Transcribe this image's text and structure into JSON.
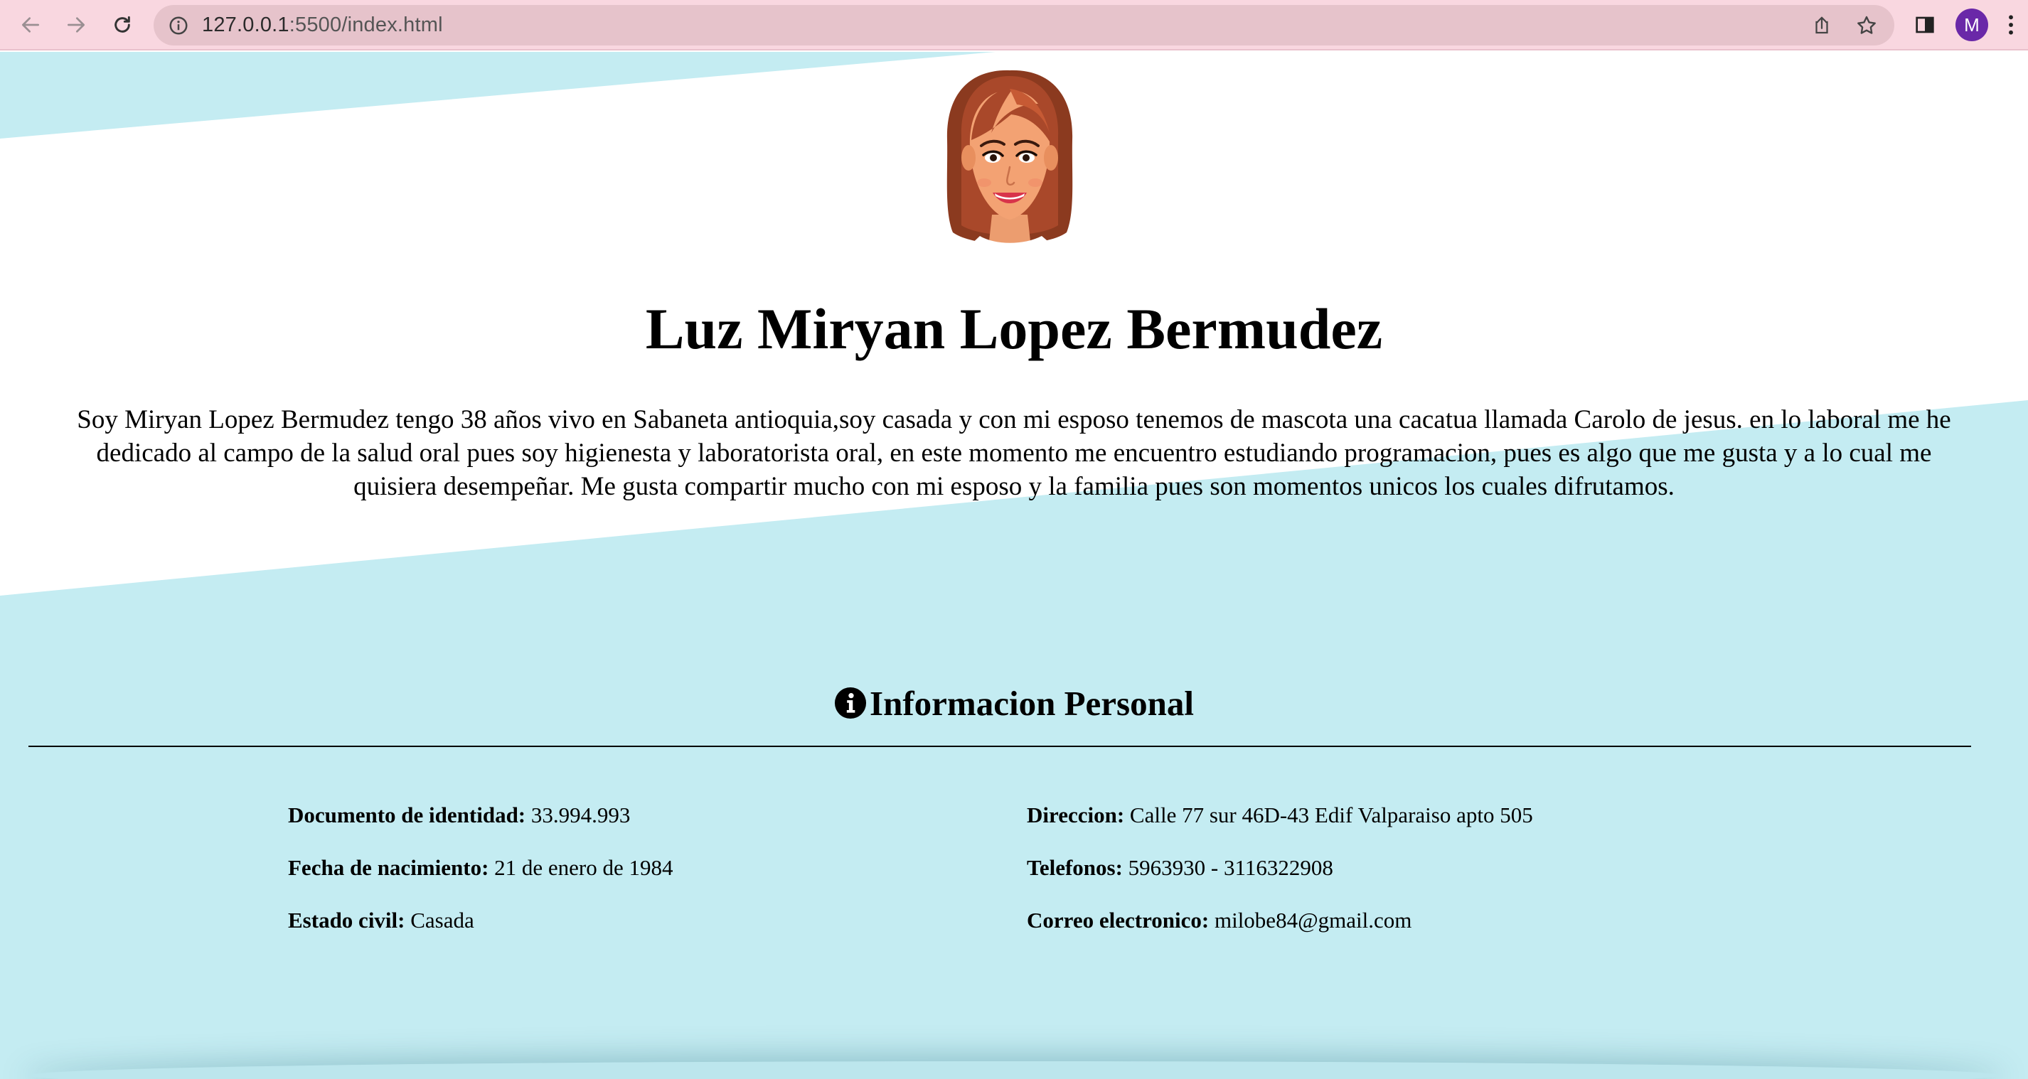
{
  "browser": {
    "url_host": "127.0.0.1",
    "url_path": ":5500/index.html",
    "profile_initial": "M",
    "icons": {
      "back": "arrow-left-icon",
      "forward": "arrow-right-icon",
      "reload": "reload-icon",
      "site_info": "info-circle-icon",
      "share": "share-icon",
      "bookmark": "star-icon",
      "side_panel": "side-panel-icon",
      "menu": "kebab-menu-icon"
    },
    "colors": {
      "chrome_bg": "#f9d7e0",
      "omnibox_bg": "#e6c3cb",
      "avatar_bg": "#6a28a8"
    }
  },
  "page": {
    "colors": {
      "accent_band": "#c4ecf2",
      "background": "#ffffff",
      "text": "#000000"
    },
    "portrait_icon": "woman-avatar-illustration",
    "name": "Luz Miryan Lopez Bermudez",
    "bio_lines": [
      "Soy Miryan Lopez Bermudez tengo 38 años vivo en Sabaneta antioquia,soy casada y con mi esposo tenemos de mascota una cacatua llamada Carolo de jesus. en lo laboral me he",
      "dedicado al campo de la salud oral pues soy higienesta y laboratorista oral, en este momento me encuentro estudiando programacion, pues es algo que me gusta y a lo cual me",
      "quisiera desempeñar. Me gusta compartir mucho con mi esposo y la familia pues son momentos unicos los cuales difrutamos."
    ],
    "section": {
      "icon": "info-circle-icon",
      "title": "Informacion Personal"
    },
    "personal_info": {
      "left": [
        {
          "label": "Documento de identidad:",
          "value": " 33.994.993"
        },
        {
          "label": "Fecha de nacimiento:",
          "value": " 21 de enero de 1984"
        },
        {
          "label": "Estado civil:",
          "value": " Casada"
        }
      ],
      "right": [
        {
          "label": "Direccion:",
          "value": " Calle 77 sur 46D-43 Edif Valparaiso apto 505"
        },
        {
          "label": "Telefonos:",
          "value": " 5963930 - 3116322908"
        },
        {
          "label": "Correo electronico:",
          "value": " milobe84@gmail.com"
        }
      ]
    }
  }
}
